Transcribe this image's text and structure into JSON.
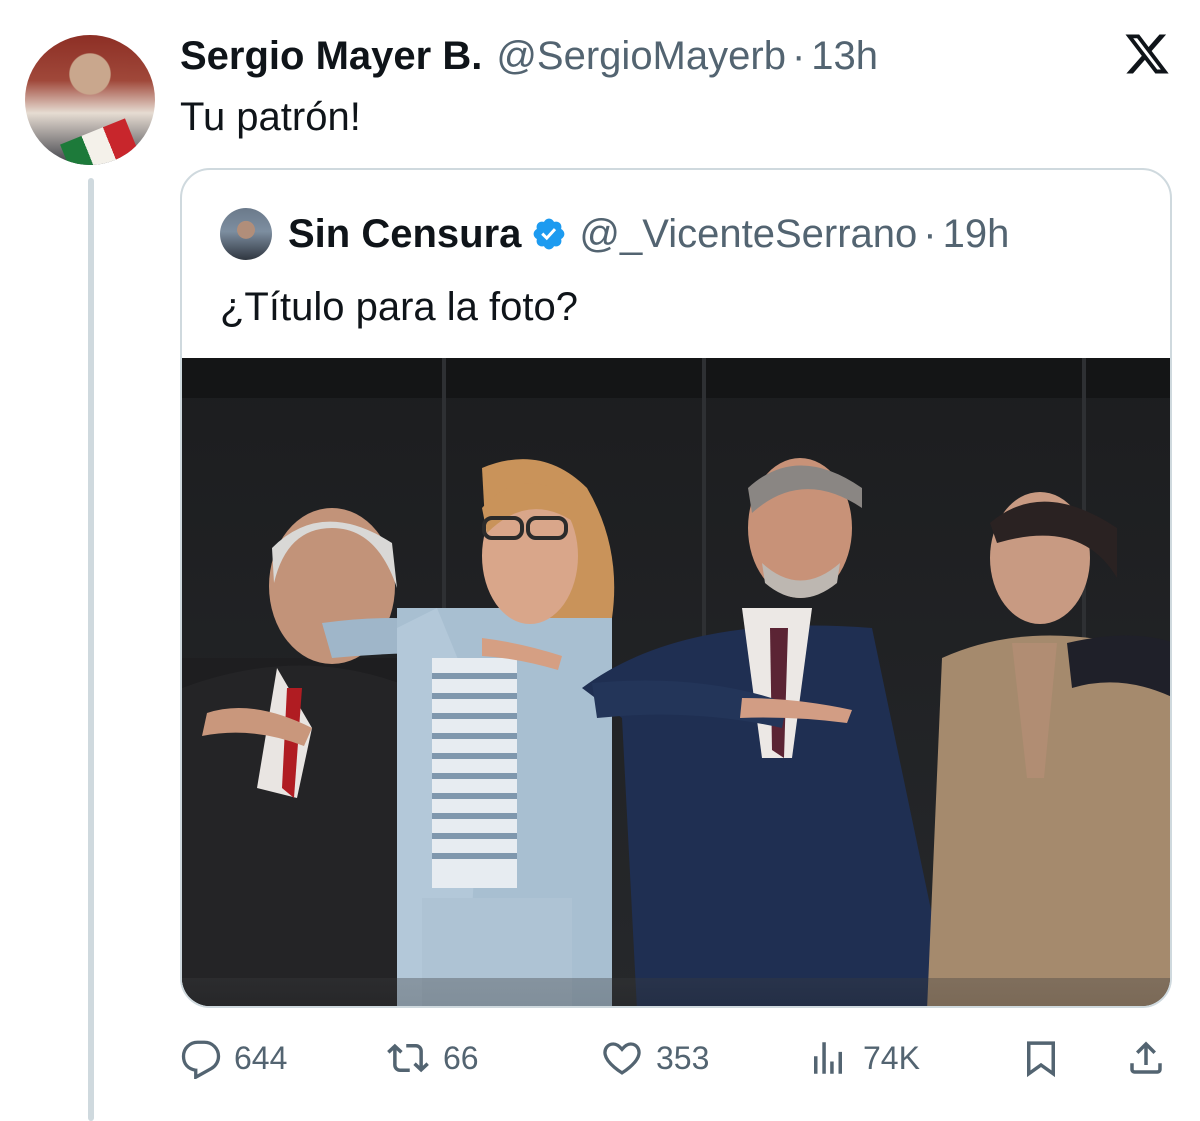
{
  "tweet": {
    "display_name": "Sergio Mayer B.",
    "handle": "@SergioMayerb",
    "separator": "·",
    "time": "13h",
    "text": "Tu patrón!"
  },
  "quote": {
    "display_name": "Sin Censura",
    "verified": true,
    "handle": "@_VicenteSerrano",
    "separator": "·",
    "time": "19h",
    "text": "¿Título para la foto?"
  },
  "actions": {
    "replies": "644",
    "reposts": "66",
    "likes": "353",
    "views": "74K"
  },
  "icons": {
    "platform": "x-logo-icon",
    "reply": "reply-icon",
    "repost": "repost-icon",
    "like": "heart-icon",
    "views": "views-icon",
    "bookmark": "bookmark-icon",
    "share": "share-icon"
  },
  "colors": {
    "text": "#0f1419",
    "secondary": "#536471",
    "border": "#cfd9de",
    "verified": "#1d9bf0"
  }
}
